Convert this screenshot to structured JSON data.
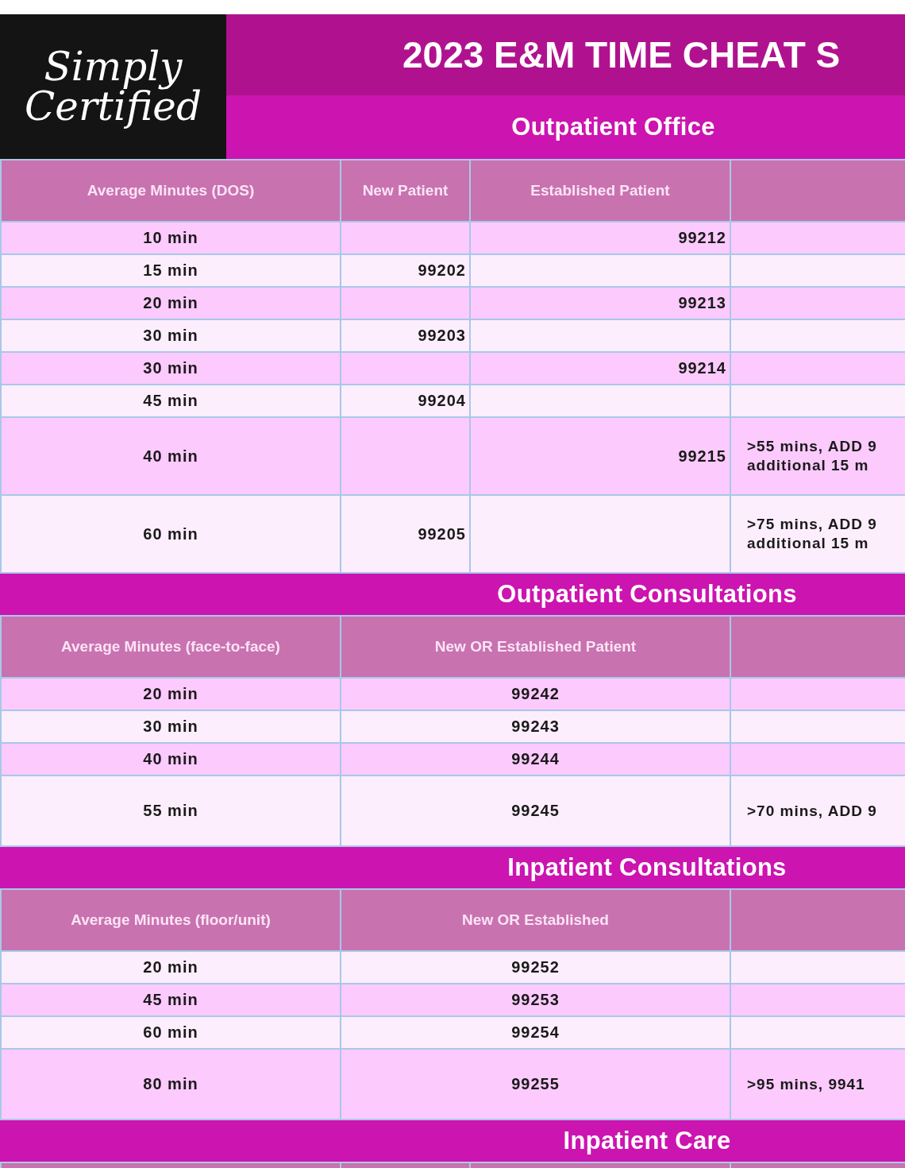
{
  "logo": {
    "line_1": "Simply",
    "line_2": "Certified"
  },
  "title": "2023 E&M TIME CHEAT S",
  "sections": [
    {
      "title": "Outpatient Office",
      "columns": [
        "Average Minutes (DOS)",
        "New Patient",
        "Established Patient"
      ],
      "rows": [
        {
          "shaded": true,
          "minutes": "10 min",
          "established": "99212"
        },
        {
          "shaded": false,
          "minutes": "15 min",
          "new": "99202"
        },
        {
          "shaded": true,
          "minutes": "20 min",
          "established": "99213"
        },
        {
          "shaded": false,
          "minutes": "30 min",
          "new": "99203"
        },
        {
          "shaded": true,
          "minutes": "30 min",
          "established": "99214"
        },
        {
          "shaded": false,
          "minutes": "45 min",
          "new": "99204"
        },
        {
          "shaded": true,
          "minutes": "40 min",
          "established": "99215",
          "note": [
            ">55 mins, ADD 9",
            "additional 15 m"
          ]
        },
        {
          "shaded": false,
          "minutes": "60 min",
          "new": "99205",
          "note": [
            ">75 mins, ADD 9",
            "additional 15 m"
          ]
        }
      ]
    },
    {
      "title": "Outpatient Consultations",
      "columns": [
        "Average Minutes (face-to-face)",
        "New OR Established Patient"
      ],
      "rows": [
        {
          "shaded": true,
          "minutes": "20 min",
          "code": "99242"
        },
        {
          "shaded": false,
          "minutes": "30 min",
          "code": "99243"
        },
        {
          "shaded": true,
          "minutes": "40 min",
          "code": "99244"
        },
        {
          "shaded": false,
          "minutes": "55 min",
          "code": "99245",
          "note": [
            ">70 mins, ADD 9"
          ]
        }
      ]
    },
    {
      "title": "Inpatient Consultations",
      "columns": [
        "Average Minutes (floor/unit)",
        "New OR Established"
      ],
      "rows": [
        {
          "shaded": false,
          "minutes": "20 min",
          "code": "99252"
        },
        {
          "shaded": true,
          "minutes": "45 min",
          "code": "99253"
        },
        {
          "shaded": false,
          "minutes": "60 min",
          "code": "99254"
        },
        {
          "shaded": true,
          "minutes": "80 min",
          "code": "99255",
          "note": [
            ">95 mins, 9941"
          ]
        }
      ]
    },
    {
      "title": "Inpatient Care"
    }
  ]
}
